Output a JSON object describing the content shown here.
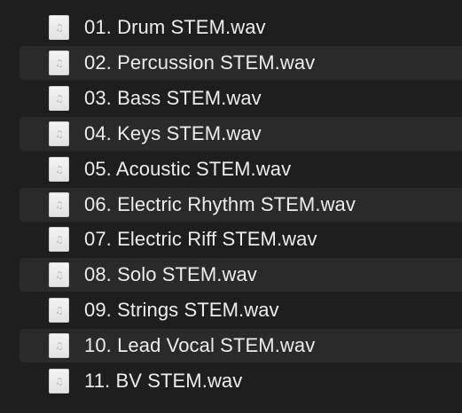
{
  "files": [
    {
      "name": "01. Drum STEM.wav",
      "icon": "audio-file-icon",
      "icon_glyph": "♫"
    },
    {
      "name": "02. Percussion STEM.wav",
      "icon": "audio-file-icon",
      "icon_glyph": "♫"
    },
    {
      "name": "03. Bass STEM.wav",
      "icon": "audio-file-icon",
      "icon_glyph": "♫"
    },
    {
      "name": "04. Keys STEM.wav",
      "icon": "audio-file-icon",
      "icon_glyph": "♫"
    },
    {
      "name": "05. Acoustic STEM.wav",
      "icon": "audio-file-icon",
      "icon_glyph": "♫"
    },
    {
      "name": "06. Electric Rhythm STEM.wav",
      "icon": "audio-file-icon",
      "icon_glyph": "♫"
    },
    {
      "name": "07. Electric Riff STEM.wav",
      "icon": "audio-file-icon",
      "icon_glyph": "♫"
    },
    {
      "name": "08. Solo STEM.wav",
      "icon": "audio-file-icon",
      "icon_glyph": "♫"
    },
    {
      "name": "09. Strings STEM.wav",
      "icon": "audio-file-icon",
      "icon_glyph": "♫"
    },
    {
      "name": "10. Lead Vocal STEM.wav",
      "icon": "audio-file-icon",
      "icon_glyph": "♫"
    },
    {
      "name": "11. BV STEM.wav",
      "icon": "audio-file-icon",
      "icon_glyph": "♫"
    }
  ],
  "colors": {
    "background": "#1e1e1e",
    "row_alternate": "#2a2a2a",
    "text": "#ececec",
    "icon_fill": "#f0f0f0"
  }
}
